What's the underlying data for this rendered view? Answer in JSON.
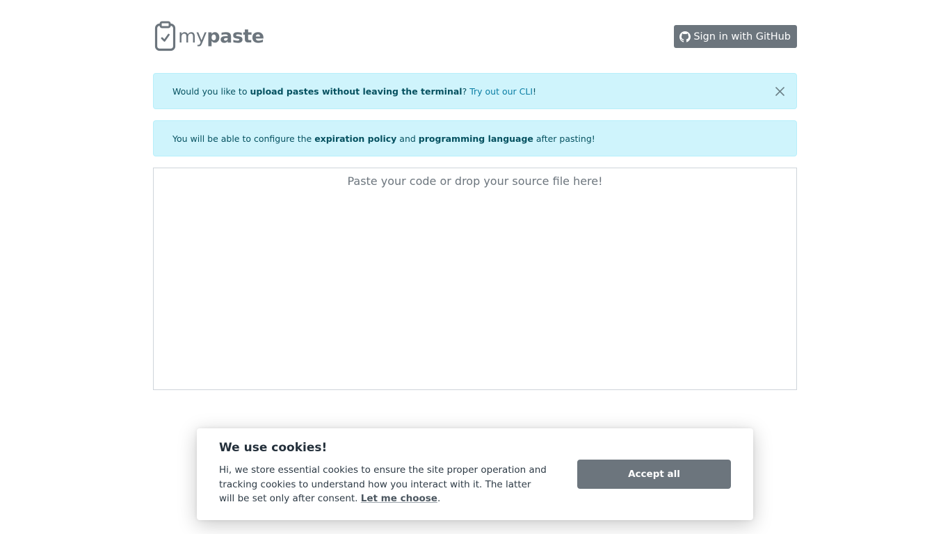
{
  "header": {
    "logo": {
      "icon": "clipboard-check-icon",
      "text_light": "my",
      "text_bold": "paste"
    },
    "github_button": {
      "icon": "github-icon",
      "label": "Sign in with GitHub"
    }
  },
  "alerts": [
    {
      "prefix": "Would you like to ",
      "bold": "upload pastes without leaving the terminal",
      "middle": "? ",
      "link": "Try out our CLI",
      "suffix": "!",
      "close_icon": "close-icon"
    },
    {
      "prefix": "You will be able to configure the ",
      "bold1": "expiration policy",
      "middle": " and ",
      "bold2": "programming language",
      "suffix": " after pasting!"
    }
  ],
  "editor": {
    "placeholder": "Paste your code or drop your source file here!",
    "value": ""
  },
  "cookie_banner": {
    "title": "We use cookies!",
    "text": "Hi, we store essential cookies to ensure the site proper operation and tracking cookies to understand how you interact with it. The latter will be set only after consent. ",
    "link": "Let me choose",
    "suffix": ".",
    "accept_label": "Accept all"
  },
  "colors": {
    "primary_gray": "#6c757d",
    "alert_bg": "#cff4fc",
    "alert_text": "#055160",
    "alert_link": "#0a7ea4"
  }
}
